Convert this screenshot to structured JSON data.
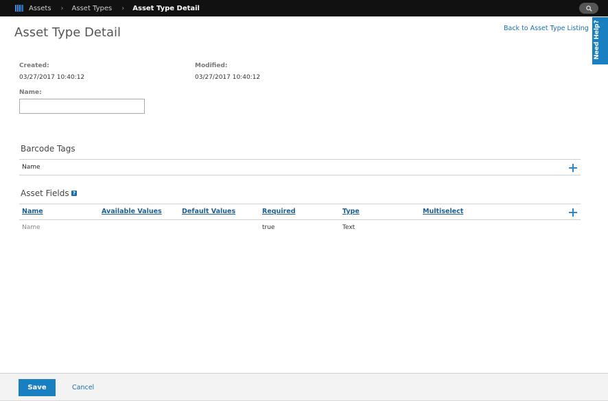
{
  "breadcrumb": {
    "items": [
      "Assets",
      "Asset Types"
    ],
    "current": "Asset Type Detail"
  },
  "header": {
    "title": "Asset Type Detail",
    "back_link": "Back to Asset Type Listing",
    "help_tab": "Need Help?"
  },
  "meta": {
    "created_label": "Created:",
    "created_value": "03/27/2017 10:40:12",
    "modified_label": "Modified:",
    "modified_value": "03/27/2017 10:40:12",
    "name_label": "Name:",
    "name_value": ""
  },
  "barcode_tags": {
    "title": "Barcode Tags",
    "column": "Name"
  },
  "asset_fields": {
    "title": "Asset Fields",
    "help_glyph": "?",
    "columns": [
      "Name",
      "Available Values",
      "Default Values",
      "Required",
      "Type",
      "Multiselect"
    ],
    "rows": [
      [
        "Name",
        "",
        "",
        "true",
        "Text",
        ""
      ]
    ]
  },
  "footer": {
    "save_label": "Save",
    "cancel_label": "Cancel"
  },
  "colors": {
    "accent": "#1a7fc1",
    "topbar": "#111111",
    "link": "#1a6ea8"
  },
  "icons": {
    "app": "assets-app-icon",
    "search": "search-icon",
    "add": "plus-icon",
    "info": "help-icon"
  }
}
